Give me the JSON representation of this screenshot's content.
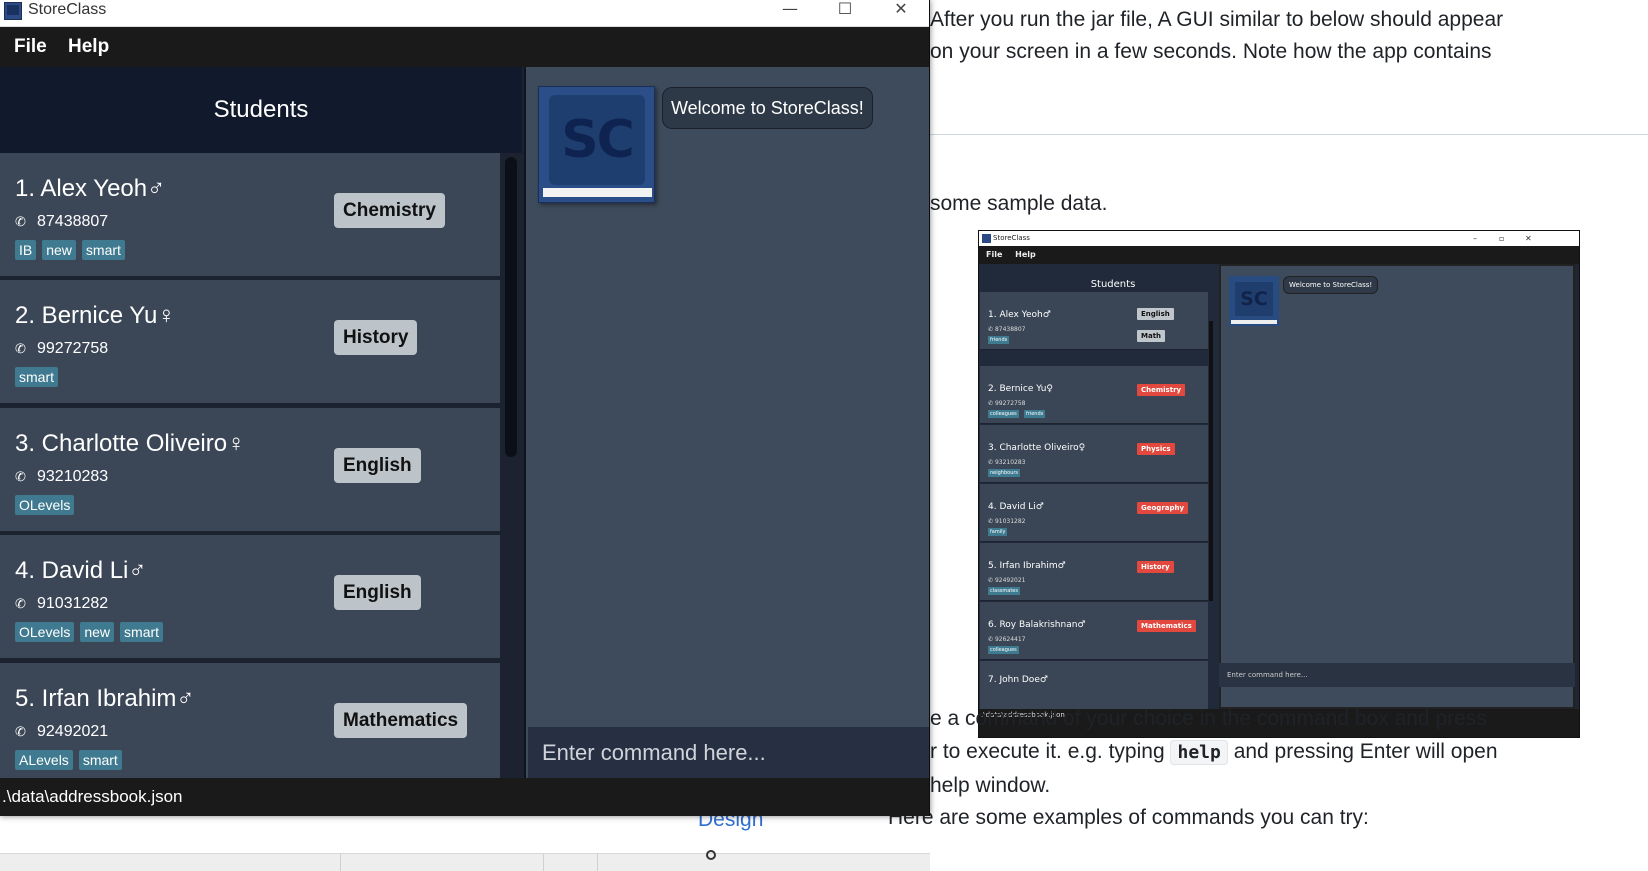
{
  "app": {
    "title": "StoreClass",
    "window_controls": {
      "minimize": "—",
      "maximize": "☐",
      "close": "✕"
    },
    "menu": [
      "File",
      "Help"
    ]
  },
  "students_header": "Students",
  "students": [
    {
      "name": "1. Alex Yeoh♂",
      "phone": "87438807",
      "tags": [
        "IB",
        "new",
        "smart"
      ],
      "subject": "Chemistry"
    },
    {
      "name": "2. Bernice Yu♀",
      "phone": "99272758",
      "tags": [
        "smart"
      ],
      "subject": "History"
    },
    {
      "name": "3. Charlotte Oliveiro♀",
      "phone": "93210283",
      "tags": [
        "OLevels"
      ],
      "subject": "English"
    },
    {
      "name": "4. David Li♂",
      "phone": "91031282",
      "tags": [
        "OLevels",
        "new",
        "smart"
      ],
      "subject": "English"
    },
    {
      "name": "5. Irfan Ibrahim♂",
      "phone": "92492021",
      "tags": [
        "ALevels",
        "smart"
      ],
      "subject": "Mathematics"
    }
  ],
  "logo_text": "SC",
  "welcome_message": "Welcome to StoreClass!",
  "command_box": {
    "value": "",
    "placeholder": "Enter command here..."
  },
  "status_bar": ".\\data\\addressbook.json",
  "document": {
    "line1": "After you run the jar file, A GUI similar to below should appear",
    "line2": "on your screen in a few seconds. Note how the app contains",
    "line3": "some sample data.",
    "line4": "e a command of your choice in the command box and press",
    "line5_pre": "r to execute it. e.g. typing",
    "line5_code": "help",
    "line5_post": "and pressing Enter will open",
    "line6": "help window.",
    "line7": "Here are some examples of commands you can try:",
    "link": "Design"
  },
  "embedded_screenshot": {
    "title": "StoreClass",
    "menu": [
      "File",
      "Help"
    ],
    "students_header": "Students",
    "welcome": "Welcome to StoreClass!",
    "command_placeholder": "Enter command here...",
    "status": ".\\data\\addressbook.json",
    "students": [
      {
        "name": "1. Alex Yeoh♂",
        "phone": "87438807",
        "tags": [
          "friends"
        ],
        "subjects": [
          "English",
          "Math"
        ]
      },
      {
        "name": "2. Bernice Yu♀",
        "phone": "99272758",
        "tags": [
          "colleagues",
          "friends"
        ],
        "subjects": [
          "Chemistry"
        ]
      },
      {
        "name": "3. Charlotte Oliveiro♀",
        "phone": "93210283",
        "tags": [
          "neighbours"
        ],
        "subjects": [
          "Physics"
        ]
      },
      {
        "name": "4. David Li♂",
        "phone": "91031282",
        "tags": [
          "family"
        ],
        "subjects": [
          "Geography"
        ]
      },
      {
        "name": "5. Irfan Ibrahim♂",
        "phone": "92492021",
        "tags": [
          "classmates"
        ],
        "subjects": [
          "History"
        ]
      },
      {
        "name": "6. Roy Balakrishnan♂",
        "phone": "92624417",
        "tags": [
          "colleagues"
        ],
        "subjects": [
          "Mathematics"
        ]
      },
      {
        "name": "7. John Doe♂",
        "phone": "",
        "tags": [],
        "subjects": []
      }
    ]
  }
}
